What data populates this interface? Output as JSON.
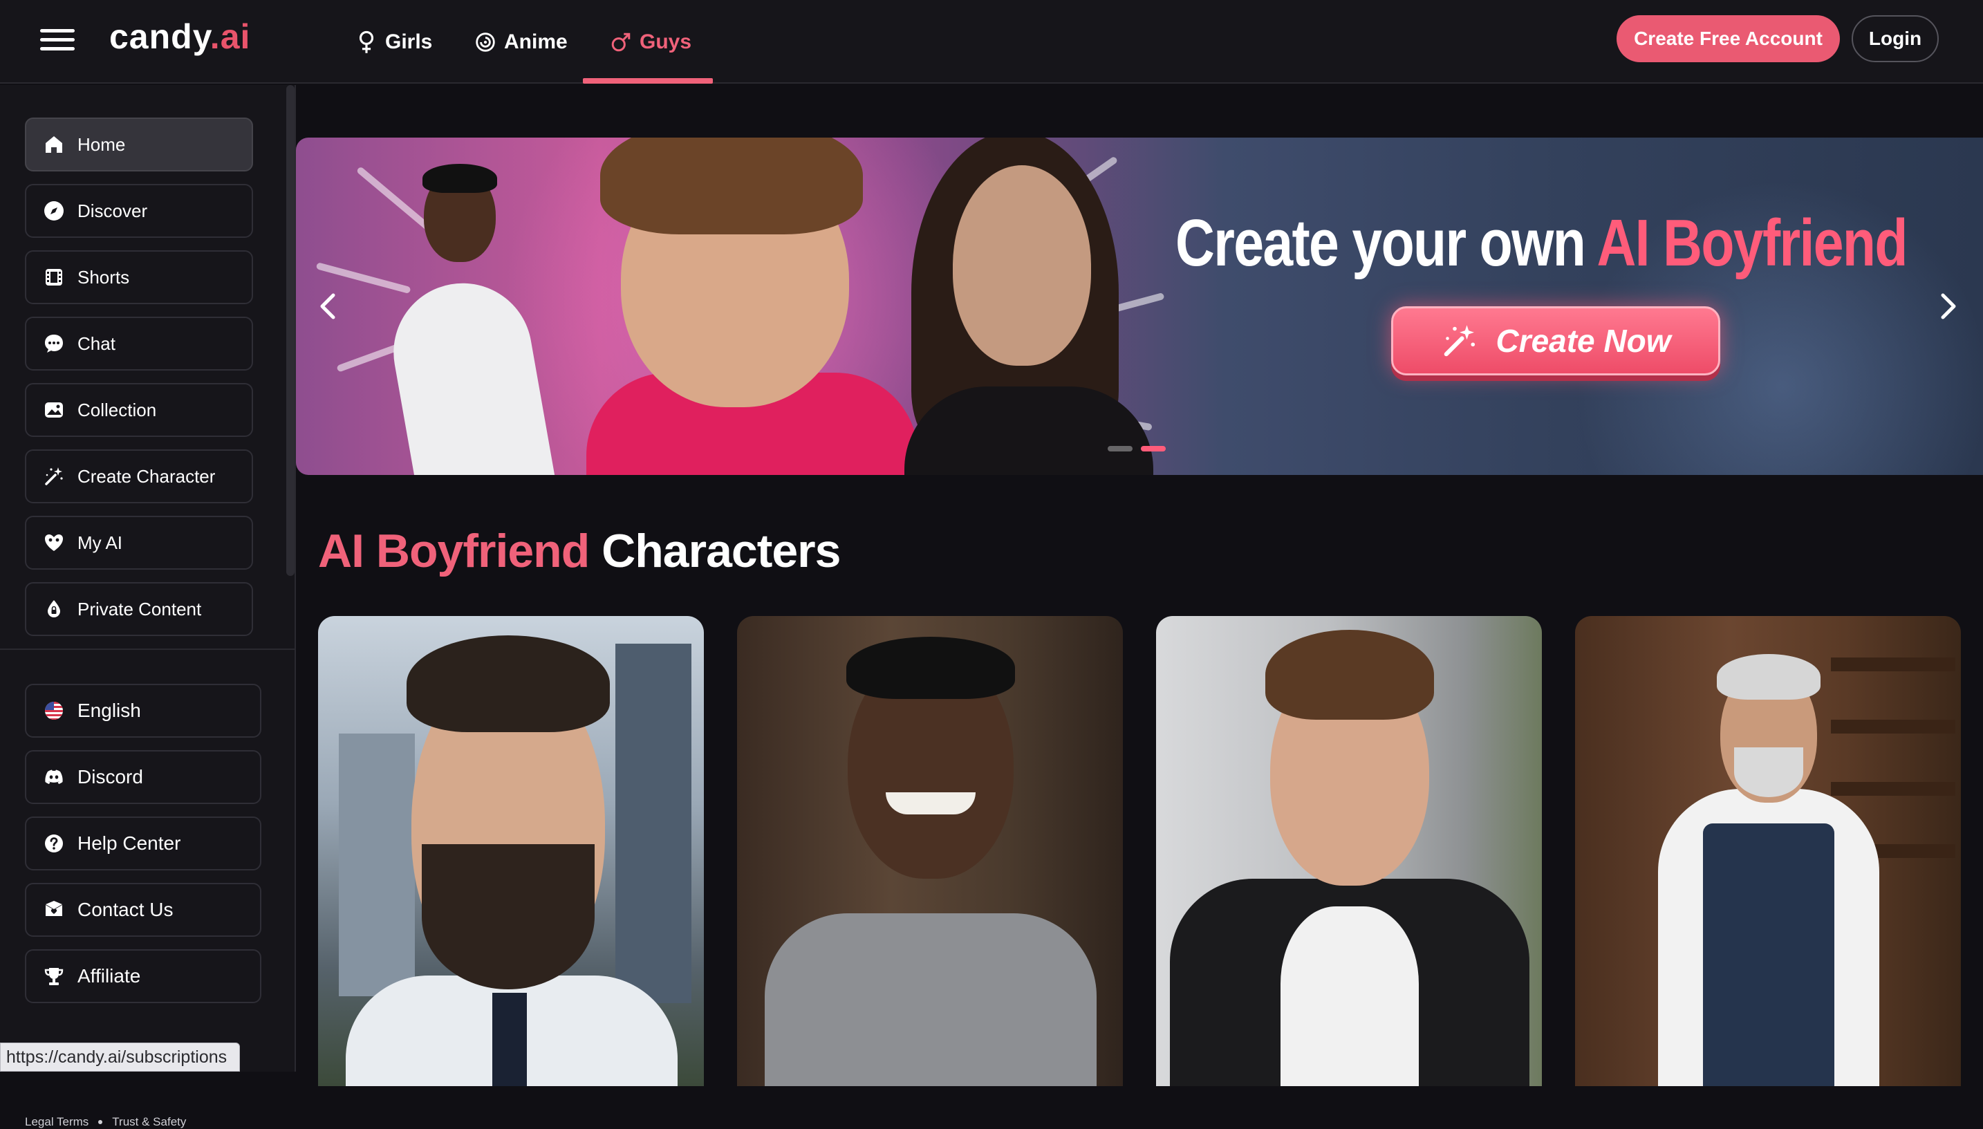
{
  "header": {
    "logo_main": "candy",
    "logo_suffix": ".ai",
    "tabs": [
      {
        "label": "Girls",
        "icon": "female-icon",
        "active": false
      },
      {
        "label": "Anime",
        "icon": "anime-swirl-icon",
        "active": false
      },
      {
        "label": "Guys",
        "icon": "male-icon",
        "active": true
      }
    ],
    "create_account_label": "Create Free Account",
    "login_label": "Login"
  },
  "sidebar": {
    "items": [
      {
        "label": "Home",
        "icon": "home-icon",
        "active": true
      },
      {
        "label": "Discover",
        "icon": "compass-icon"
      },
      {
        "label": "Shorts",
        "icon": "film-icon"
      },
      {
        "label": "Chat",
        "icon": "chat-bubble-icon"
      },
      {
        "label": "Collection",
        "icon": "image-gallery-icon"
      },
      {
        "label": "Create Character",
        "icon": "magic-wand-icon"
      },
      {
        "label": "My AI",
        "icon": "heart-mask-icon"
      },
      {
        "label": "Private Content",
        "icon": "lock-drop-icon"
      }
    ],
    "footer_items": [
      {
        "label": "English",
        "icon": "us-flag-icon"
      },
      {
        "label": "Discord",
        "icon": "discord-icon"
      },
      {
        "label": "Help Center",
        "icon": "question-icon"
      },
      {
        "label": "Contact Us",
        "icon": "envelope-heart-icon"
      },
      {
        "label": "Affiliate",
        "icon": "trophy-icon"
      }
    ],
    "legal_links": [
      "Legal Terms",
      "Trust & Safety"
    ]
  },
  "status_bar": {
    "url": "https://candy.ai/subscriptions"
  },
  "banner": {
    "headline_white": "Create your own ",
    "headline_pink": "AI Boyfriend",
    "cta_label": "Create Now",
    "slide_count": 2,
    "active_slide": 2
  },
  "section": {
    "title_pink": "AI Boyfriend",
    "title_white": " Characters"
  },
  "characters": [
    {
      "name": "character-card-businessman"
    },
    {
      "name": "character-card-smiling-man"
    },
    {
      "name": "character-card-young-man"
    },
    {
      "name": "character-card-older-man"
    }
  ],
  "colors": {
    "accent": "#f0627a",
    "button_pink": "#ea5a72",
    "background": "#100f14",
    "panel": "#16151a"
  }
}
